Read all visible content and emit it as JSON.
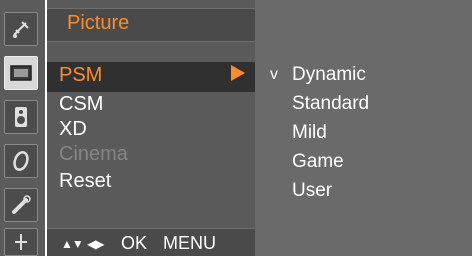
{
  "sidebar": {
    "icons": [
      "satellite-icon",
      "picture-icon",
      "sound-icon",
      "time-icon",
      "option-icon",
      "screen-icon"
    ],
    "active_index": 1
  },
  "menu": {
    "title": "Picture",
    "items": [
      {
        "label": "PSM",
        "state": "selected"
      },
      {
        "label": "CSM",
        "state": "normal"
      },
      {
        "label": "XD",
        "state": "normal"
      },
      {
        "label": "Cinema",
        "state": "disabled"
      },
      {
        "label": "Reset",
        "state": "normal"
      }
    ],
    "footer": {
      "updown": "▲▼",
      "leftright": "◀▶",
      "ok": "OK",
      "menu": "MENU"
    }
  },
  "submenu": {
    "check": "v",
    "items": [
      "Dynamic",
      "Standard",
      "Mild",
      "Game",
      "User"
    ],
    "checked_index": 0
  },
  "colors": {
    "accent": "#ff8c28",
    "menu_bg": "#5a5a5a",
    "submenu_bg": "#6a6a6a"
  }
}
